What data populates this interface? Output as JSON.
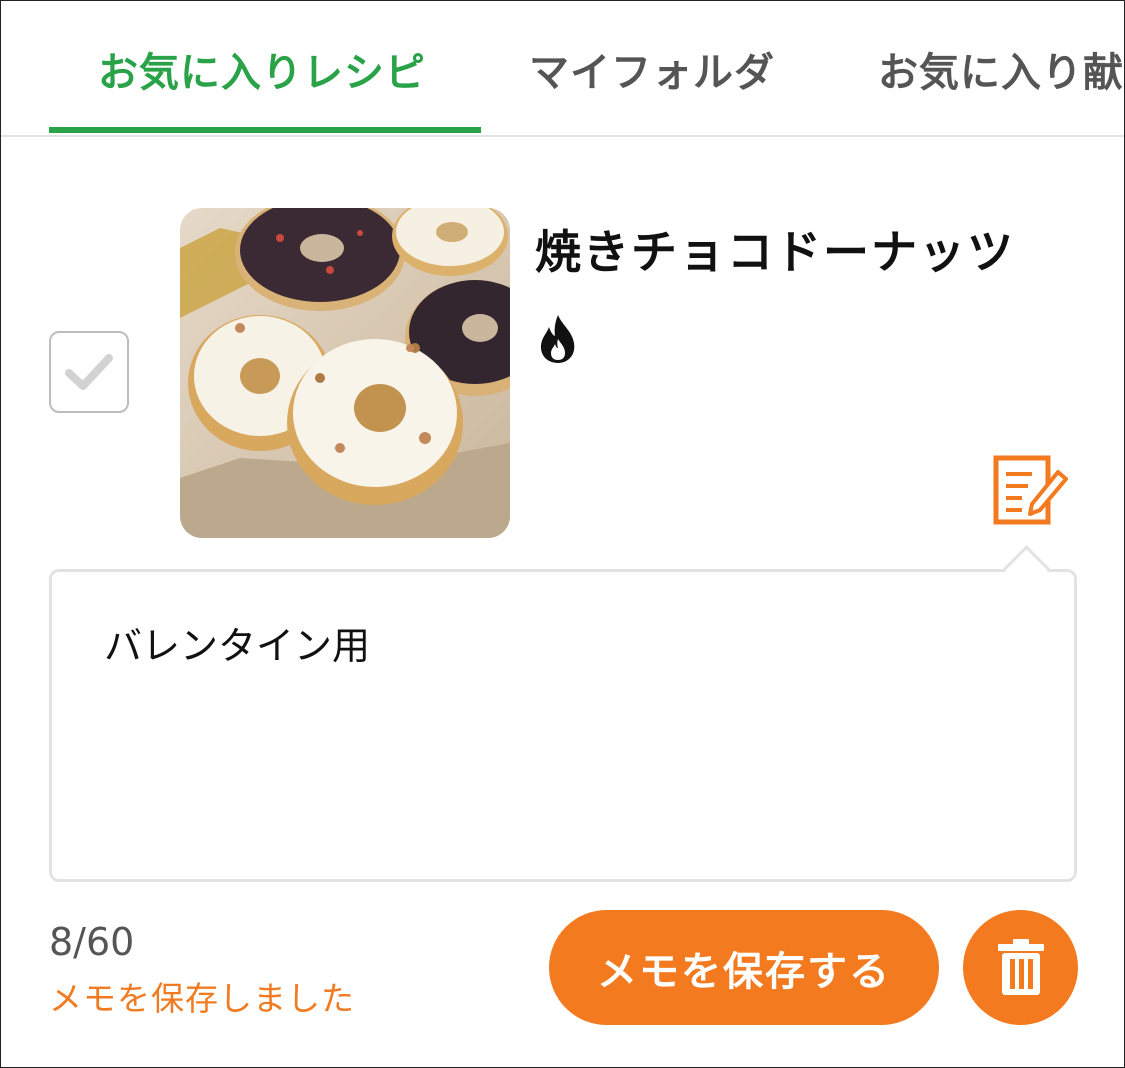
{
  "tabs": [
    {
      "label": "お気に入りレシピ",
      "active": true
    },
    {
      "label": "マイフォルダ",
      "active": false
    },
    {
      "label": "お気に入り献",
      "active": false
    }
  ],
  "colors": {
    "accent_green": "#2aa248",
    "accent_orange": "#f47a1f",
    "border_gray": "#e3e3e3"
  },
  "recipe": {
    "title": "焼きチョコドーナッツ",
    "badge_icon": "fire-icon",
    "checked": false
  },
  "memo": {
    "text": "バレンタイン用",
    "counter": "8/60",
    "status": "メモを保存しました"
  },
  "actions": {
    "save_label": "メモを保存する",
    "delete_icon": "trash-icon",
    "edit_icon": "memo-edit-icon"
  }
}
